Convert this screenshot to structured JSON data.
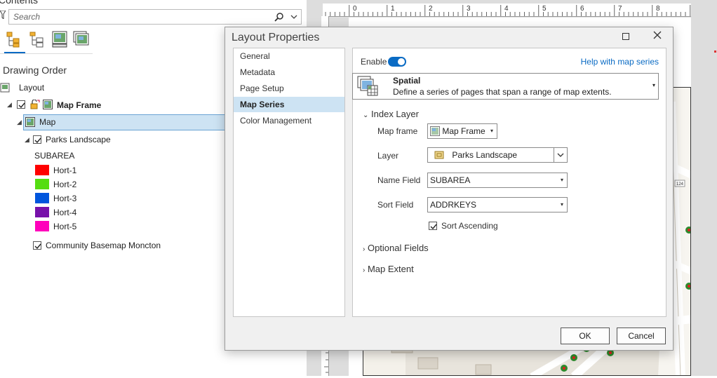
{
  "contents": {
    "title": "Contents",
    "search_placeholder": "Search",
    "toolbar_icons": [
      "list-by-drawing-order-icon",
      "list-by-source-icon",
      "list-by-selection-icon",
      "list-by-editing-icon"
    ],
    "drawing_order_label": "Drawing Order",
    "tree": {
      "layout": "Layout",
      "map_frame": "Map Frame",
      "map": "Map",
      "layer": "Parks Landscape",
      "field_header": "SUBAREA",
      "classes": [
        {
          "label": "Hort-1",
          "color": "#ff0000"
        },
        {
          "label": "Hort-2",
          "color": "#55dd11"
        },
        {
          "label": "Hort-3",
          "color": "#0055dd"
        },
        {
          "label": "Hort-4",
          "color": "#7711aa"
        },
        {
          "label": "Hort-5",
          "color": "#ff00bb"
        }
      ],
      "basemap": "Community Basemap Moncton"
    }
  },
  "ruler": {
    "labels": [
      "0",
      "1",
      "2",
      "3",
      "4",
      "5",
      "6",
      "7",
      "8"
    ]
  },
  "map": {
    "labels": [
      "124"
    ]
  },
  "dialog": {
    "title": "Layout Properties",
    "nav": [
      "General",
      "Metadata",
      "Page Setup",
      "Map Series",
      "Color Management"
    ],
    "active_nav": "Map Series",
    "enable_label": "Enable",
    "enabled": true,
    "help_link": "Help with map series",
    "series_type": {
      "name": "Spatial",
      "description": "Define a series of pages that span a range of map extents."
    },
    "index_layer": {
      "header": "Index Layer",
      "map_frame_label": "Map frame",
      "map_frame_value": "Map Frame",
      "layer_label": "Layer",
      "layer_value": "Parks Landscape",
      "name_field_label": "Name Field",
      "name_field_value": "SUBAREA",
      "sort_field_label": "Sort Field",
      "sort_field_value": "ADDRKEYS",
      "sort_ascending_label": "Sort Ascending",
      "sort_ascending": true
    },
    "optional_fields": "Optional Fields",
    "map_extent": "Map Extent",
    "ok": "OK",
    "cancel": "Cancel",
    "colors": {
      "accent": "#0a6bc4",
      "selected": "#cde3f3"
    }
  }
}
